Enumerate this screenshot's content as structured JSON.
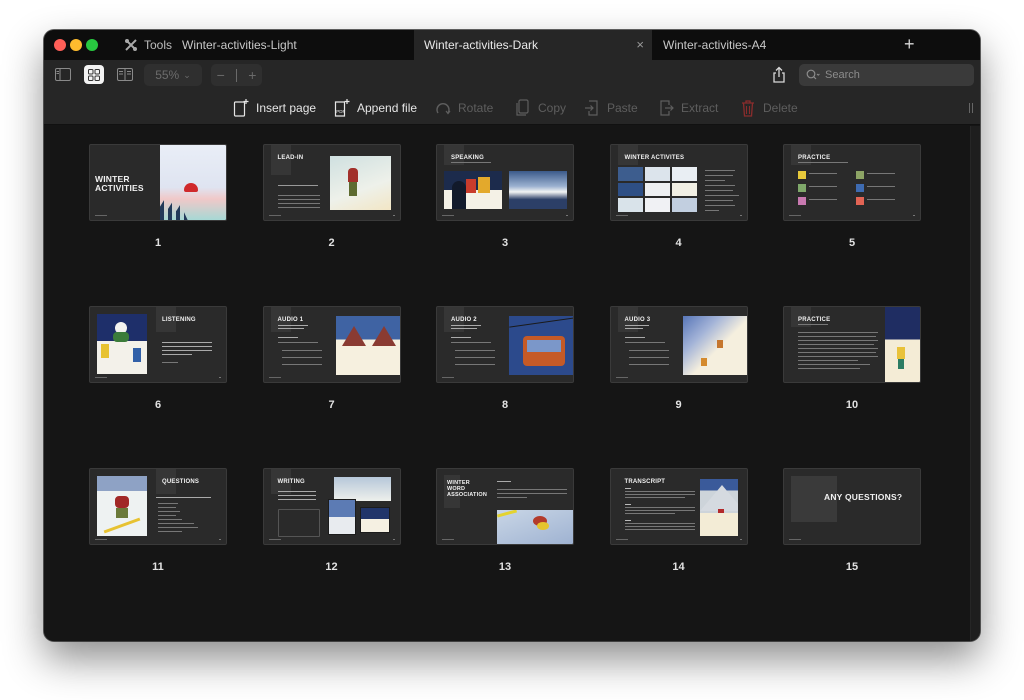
{
  "window": {
    "toolbar_tools_label": "Tools",
    "tabs": [
      {
        "label": "Winter-activities-Light",
        "active": false
      },
      {
        "label": "Winter-activities-Dark",
        "active": true
      },
      {
        "label": "Winter-activities-A4",
        "active": false
      }
    ],
    "new_tab_label": "+",
    "close_tab_label": "×"
  },
  "toolbar": {
    "view_modes": [
      "sidebar-view",
      "grid-view",
      "two-page-view"
    ],
    "active_view": "grid-view",
    "zoom_level": "55%",
    "zoom_out_label": "−",
    "zoom_in_label": "+",
    "search_placeholder": "Search"
  },
  "actions": {
    "insert_page": "Insert page",
    "append_file": "Append file",
    "rotate": "Rotate",
    "copy": "Copy",
    "paste": "Paste",
    "extract": "Extract",
    "delete": "Delete"
  },
  "colors": {
    "accent_delete": "#8a2c2c",
    "window_bg": "#151515",
    "toolbar_bg": "#262626"
  },
  "pages": [
    {
      "number": "1",
      "title": "WINTER ACTIVITIES"
    },
    {
      "number": "2",
      "title": "LEAD-IN"
    },
    {
      "number": "3",
      "title": "SPEAKING"
    },
    {
      "number": "4",
      "title": "WINTER ACTIVITES"
    },
    {
      "number": "5",
      "title": "PRACTICE"
    },
    {
      "number": "6",
      "title": "LISTENING"
    },
    {
      "number": "7",
      "title": "AUDIO 1"
    },
    {
      "number": "8",
      "title": "AUDIO 2"
    },
    {
      "number": "9",
      "title": "AUDIO 3"
    },
    {
      "number": "10",
      "title": "PRACTICE"
    },
    {
      "number": "11",
      "title": "QUESTIONS"
    },
    {
      "number": "12",
      "title": "WRITING"
    },
    {
      "number": "13",
      "title": "WINTER WORD ASSOCIATION"
    },
    {
      "number": "14",
      "title": "TRANSCRIPT"
    },
    {
      "number": "15",
      "title": "ANY QUESTIONS?"
    }
  ]
}
